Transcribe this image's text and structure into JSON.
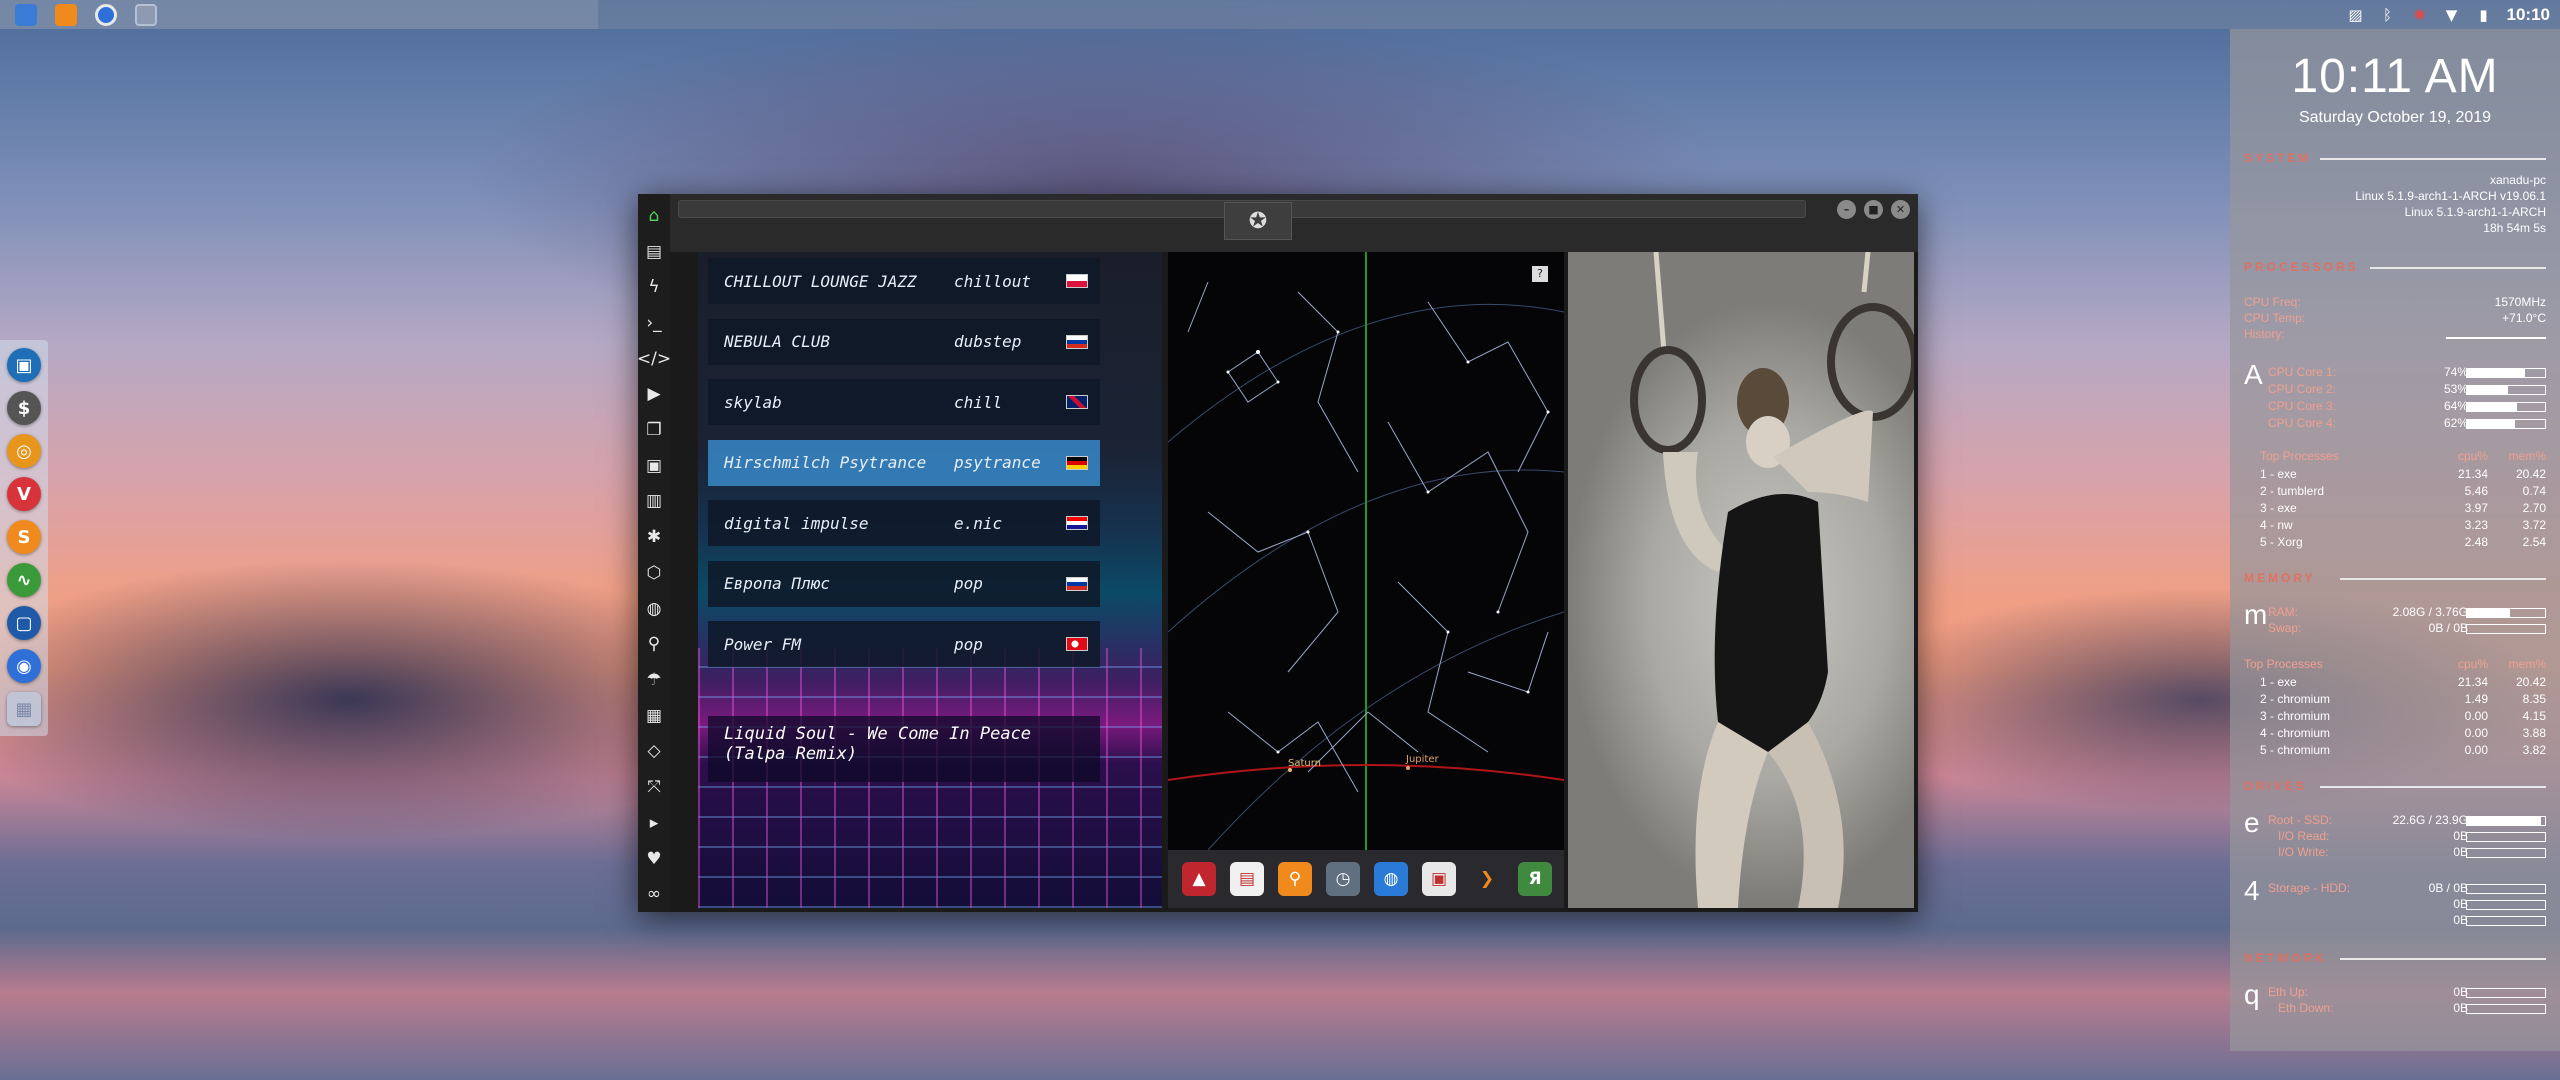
{
  "top_panel": {
    "launcher_icons": [
      "files-icon",
      "sublime-icon",
      "chromium-icon",
      "workspace-icon"
    ],
    "clock": "10:10"
  },
  "left_dock": {
    "items": [
      {
        "name": "files-icon",
        "glyph": "▣",
        "color": "#1e6fb8"
      },
      {
        "name": "terminal-icon",
        "glyph": "$",
        "color": "#555555"
      },
      {
        "name": "ubuntu-icon",
        "glyph": "◎",
        "color": "#e8951b"
      },
      {
        "name": "vivaldi-icon",
        "glyph": "V",
        "color": "#d7333a"
      },
      {
        "name": "sublime-icon",
        "glyph": "S",
        "color": "#f08a1c"
      },
      {
        "name": "system-monitor-icon",
        "glyph": "∿",
        "color": "#3a9a3a"
      },
      {
        "name": "screenshot-icon",
        "glyph": "▢",
        "color": "#1f5aa8"
      },
      {
        "name": "chromium-icon",
        "glyph": "◉",
        "color": "#2f6fd8"
      },
      {
        "name": "workspace-grid-icon",
        "glyph": "▦",
        "color": "#c0c8da"
      }
    ]
  },
  "window": {
    "sidebar_icons": [
      "home-icon",
      "document-icon",
      "bolt-icon",
      "terminal-icon",
      "code-icon",
      "play-icon",
      "copy-icon",
      "image-icon",
      "news-icon",
      "settings-icon",
      "hexagon-icon",
      "globe-icon",
      "search-icon",
      "umbrella-icon",
      "id-card-icon",
      "tag-icon",
      "expand-icon",
      "youtube-icon",
      "heart-icon",
      "link-icon"
    ],
    "radio": {
      "stations": [
        {
          "name": "CHILLOUT LOUNGE JAZZ",
          "genre": "chillout",
          "flag": "pl"
        },
        {
          "name": "NEBULA CLUB",
          "genre": "dubstep",
          "flag": "ru"
        },
        {
          "name": "skylab",
          "genre": "chill",
          "flag": "gb"
        },
        {
          "name": "Hirschmilch Psytrance",
          "genre": "psytrance",
          "flag": "de"
        },
        {
          "name": "digital impulse",
          "genre": "e.nic",
          "flag": "hr"
        },
        {
          "name": "Европа Плюс",
          "genre": "pop",
          "flag": "ru"
        },
        {
          "name": "Power FM",
          "genre": "pop",
          "flag": "tr"
        }
      ],
      "now_playing": "Liquid Soul - We Come In Peace (Talpa Remix)"
    },
    "star_map": {
      "help": "?",
      "labels": {
        "saturn": "Saturn",
        "jupiter": "Jupiter"
      },
      "dock_icons": [
        {
          "name": "app-a-icon",
          "glyph": "▲",
          "color": "#c0262e"
        },
        {
          "name": "calendar-icon",
          "glyph": "▤",
          "color": "#f0f0f0"
        },
        {
          "name": "search-icon",
          "glyph": "⚲",
          "color": "#f08a1c"
        },
        {
          "name": "clock-icon",
          "glyph": "◷",
          "color": "#607080"
        },
        {
          "name": "globe-icon",
          "glyph": "◍",
          "color": "#2a7ad8"
        },
        {
          "name": "calendar-clock-icon",
          "glyph": "▣",
          "color": "#e8e8e8"
        },
        {
          "name": "arrow-icon",
          "glyph": "❯",
          "color": "#2a2a2e"
        },
        {
          "name": "yandex-icon",
          "glyph": "Я",
          "color": "#3f8a3f"
        }
      ]
    }
  },
  "conky": {
    "time": "10:11 AM",
    "date": "Saturday October 19, 2019",
    "system": {
      "hostname": "xanadu-pc",
      "kernel1": "Linux 5.1.9-arch1-1-ARCH v19.06.1",
      "kernel2": "Linux 5.1.9-arch1-1-ARCH",
      "uptime": "18h 54m 5s"
    },
    "processors": {
      "cpu_freq_label": "CPU Freq:",
      "cpu_freq": "1570MHz",
      "cpu_temp_label": "CPU Temp:",
      "cpu_temp": "+71.0°C",
      "history_label": "History:",
      "glyph": "A",
      "cores": [
        {
          "label": "CPU Core 1:",
          "value": "74%",
          "fill": 0.74
        },
        {
          "label": "CPU Core 2:",
          "value": "53%",
          "fill": 0.53
        },
        {
          "label": "CPU Core 3:",
          "value": "64%",
          "fill": 0.64
        },
        {
          "label": "CPU Core 4:",
          "value": "62%",
          "fill": 0.62
        }
      ],
      "top_label": "Top Processes",
      "col1": "cpu%",
      "col2": "mem%",
      "top": [
        {
          "name": "1 - exe",
          "c1": "21.34",
          "c2": "20.42"
        },
        {
          "name": "2 - tumblerd",
          "c1": "5.46",
          "c2": "0.74"
        },
        {
          "name": "3 - exe",
          "c1": "3.97",
          "c2": "2.70"
        },
        {
          "name": "4 - nw",
          "c1": "3.23",
          "c2": "3.72"
        },
        {
          "name": "5 - Xorg",
          "c1": "2.48",
          "c2": "2.54"
        }
      ]
    },
    "memory": {
      "glyph": "m",
      "ram_label": "RAM:",
      "ram": "2.08G / 3.76G",
      "ram_fill": 0.55,
      "swap_label": "Swap:",
      "swap": "0B / 0B",
      "top_label": "Top Processes",
      "col1": "cpu%",
      "col2": "mem%",
      "top": [
        {
          "name": "1 - exe",
          "c1": "21.34",
          "c2": "20.42"
        },
        {
          "name": "2 - chromium",
          "c1": "1.49",
          "c2": "8.35"
        },
        {
          "name": "3 - chromium",
          "c1": "0.00",
          "c2": "4.15"
        },
        {
          "name": "4 - chromium",
          "c1": "0.00",
          "c2": "3.88"
        },
        {
          "name": "5 - chromium",
          "c1": "0.00",
          "c2": "3.82"
        }
      ]
    },
    "drives": {
      "title": "DRIVES",
      "glyph1": "e",
      "root_label": "Root - SSD:",
      "root": "22.6G / 23.9G",
      "root_fill": 0.95,
      "io_read_label": "I/O Read:",
      "io_read": "0B",
      "io_write_label": "I/O Write:",
      "io_write": "0B",
      "glyph2": "4",
      "storage_label": "Storage - HDD:",
      "storage": "0B / 0B",
      "s_read": "0B",
      "s_write": "0B"
    },
    "network": {
      "title": "NETWORK",
      "glyph": "q",
      "up_label": "Eth Up:",
      "up": "0B",
      "down_label": "Eth Down:",
      "down": "0B"
    },
    "section_titles": {
      "system": "SYSTEM",
      "processors": "PROCESSORS",
      "memory": "MEMORY"
    }
  }
}
